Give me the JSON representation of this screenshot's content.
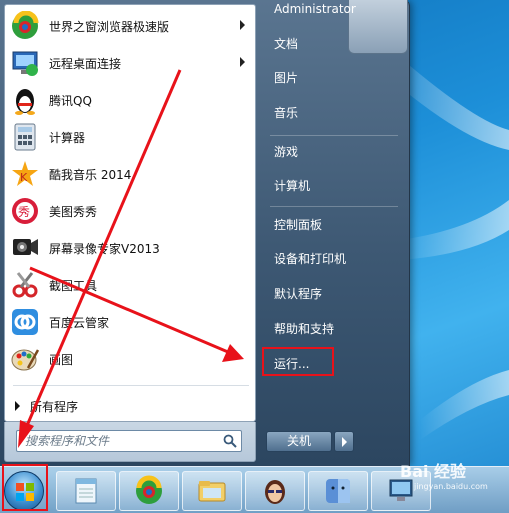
{
  "start_menu": {
    "programs": [
      {
        "label": "世界之窗浏览器极速版",
        "icon": "theworld-browser-icon",
        "has_submenu": true
      },
      {
        "label": "远程桌面连接",
        "icon": "remote-desktop-icon",
        "has_submenu": true
      },
      {
        "label": "腾讯QQ",
        "icon": "qq-penguin-icon",
        "has_submenu": false
      },
      {
        "label": "计算器",
        "icon": "calculator-icon",
        "has_submenu": false
      },
      {
        "label": "酷我音乐 2014",
        "icon": "kuwo-music-icon",
        "has_submenu": false
      },
      {
        "label": "美图秀秀",
        "icon": "meitu-xiuxiu-icon",
        "has_submenu": false
      },
      {
        "label": "屏幕录像专家V2013",
        "icon": "screen-recorder-icon",
        "has_submenu": false
      },
      {
        "label": "截图工具",
        "icon": "snipping-tool-icon",
        "has_submenu": false
      },
      {
        "label": "百度云管家",
        "icon": "baidu-cloud-icon",
        "has_submenu": false
      },
      {
        "label": "画图",
        "icon": "paint-icon",
        "has_submenu": false
      }
    ],
    "all_programs_label": "所有程序",
    "search_placeholder": "搜索程序和文件",
    "right_items": [
      {
        "label": "Administrator"
      },
      {
        "label": "文档"
      },
      {
        "label": "图片"
      },
      {
        "label": "音乐"
      },
      {
        "label": "游戏"
      },
      {
        "label": "计算机"
      },
      {
        "label": "控制面板"
      },
      {
        "label": "设备和打印机"
      },
      {
        "label": "默认程序"
      },
      {
        "label": "帮助和支持"
      },
      {
        "label": "运行..."
      }
    ],
    "shutdown_label": "关机"
  },
  "taskbar": {
    "items": [
      "notepad-icon",
      "theworld-browser-icon",
      "file-explorer-icon",
      "avatar-app-icon",
      "mac-finder-icon",
      "computer-icon"
    ]
  },
  "watermark": {
    "text": "Bai 经验",
    "sub": "jingyan.baidu.com"
  },
  "colors": {
    "highlight_red": "#e8121a",
    "arrow_red": "#e8121a"
  }
}
